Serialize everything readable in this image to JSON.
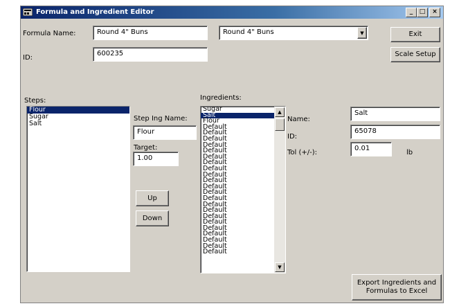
{
  "window": {
    "title": "Formula and Ingredient Editor",
    "controls": {
      "minimize": "_",
      "maximize": "□",
      "close": "×"
    }
  },
  "formula": {
    "name_label": "Formula Name:",
    "name_value": "Round 4\" Buns",
    "dropdown_value": "Round 4\" Buns",
    "id_label": "ID:",
    "id_value": "600235"
  },
  "buttons": {
    "exit": "Exit",
    "scale_setup": "Scale Setup",
    "up": "Up",
    "down": "Down",
    "export": "Export Ingredients and Formulas to Excel"
  },
  "steps": {
    "label": "Steps:",
    "items": [
      "Flour",
      "Sugar",
      "Salt"
    ],
    "selected_index": 0
  },
  "step_detail": {
    "ing_name_label": "Step Ing Name:",
    "ing_name_value": "Flour",
    "target_label": "Target:",
    "target_value": "1.00"
  },
  "ingredients": {
    "label": "Ingredients:",
    "items": [
      "Sugar",
      "Salt",
      "Flour",
      "Default",
      "Default",
      "Default",
      "Default",
      "Default",
      "Default",
      "Default",
      "Default",
      "Default",
      "Default",
      "Default",
      "Default",
      "Default",
      "Default",
      "Default",
      "Default",
      "Default",
      "Default",
      "Default",
      "Default",
      "Default",
      "Default"
    ],
    "selected_index": 1
  },
  "ingredient_detail": {
    "name_label": "Name:",
    "name_value": "Salt",
    "id_label": "ID:",
    "id_value": "65078",
    "tol_label": "Tol (+/-):",
    "tol_value": "0.01",
    "tol_unit": "lb"
  },
  "colors": {
    "titlebar": "#0a246a",
    "selection": "#0a246a",
    "face": "#d4d0c8"
  }
}
